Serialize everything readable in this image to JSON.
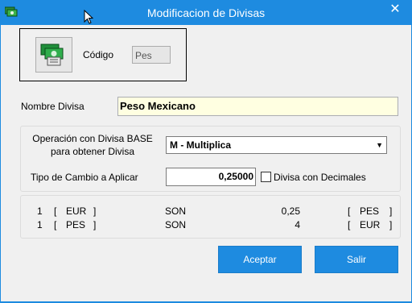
{
  "window": {
    "title": "Modificacion de Divisas",
    "close_glyph": "✕",
    "accent": "#1E8BE0"
  },
  "code_section": {
    "label": "Código",
    "value": "Pes",
    "image_icon": "banknotes-icon"
  },
  "name_section": {
    "label": "Nombre Divisa",
    "value": "Peso Mexicano"
  },
  "operation_section": {
    "label_line1": "Operación con Divisa BASE",
    "label_line2": "para obtener Divisa",
    "selected": "M - Multiplica"
  },
  "rate_section": {
    "label": "Tipo de Cambio a Aplicar",
    "value": "0,25000",
    "decimals_label": "Divisa con Decimales",
    "decimals_checked": false
  },
  "conversions": [
    {
      "qty": "1",
      "lb": "[",
      "from": "EUR",
      "rb": "]",
      "word": "SON",
      "amount": "0,25",
      "lb2": "[",
      "to": "PES",
      "rb2": "]"
    },
    {
      "qty": "1",
      "lb": "[",
      "from": "PES",
      "rb": "]",
      "word": "SON",
      "amount": "4",
      "lb2": "[",
      "to": "EUR",
      "rb2": "]"
    }
  ],
  "buttons": {
    "accept": "Aceptar",
    "exit": "Salir"
  }
}
